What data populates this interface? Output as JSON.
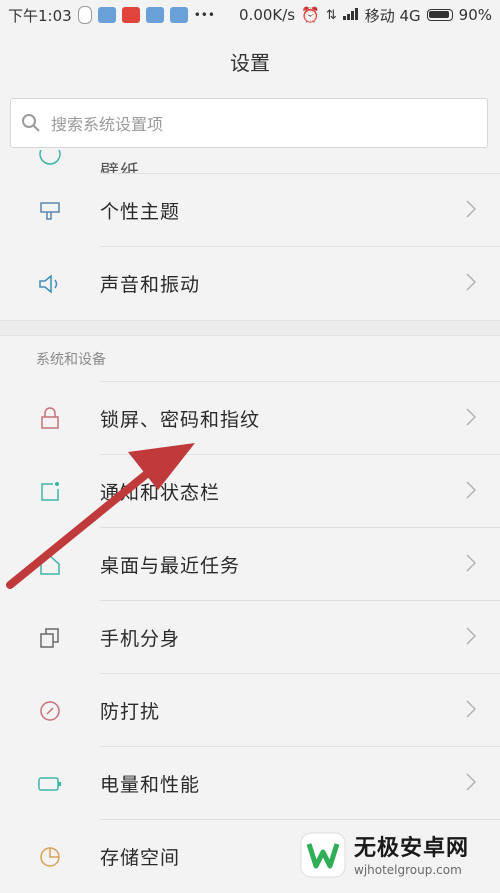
{
  "status_bar": {
    "time": "下午1:03",
    "more": "•••",
    "speed": "0.00K/s",
    "carrier": "移动 4G",
    "battery": "90%"
  },
  "header": {
    "title": "设置"
  },
  "search": {
    "placeholder": "搜索系统设置项"
  },
  "partial_item": {
    "label": "壁纸"
  },
  "items_top": [
    {
      "label": "个性主题",
      "icon": "theme-icon"
    },
    {
      "label": "声音和振动",
      "icon": "speaker-icon"
    }
  ],
  "section": {
    "title": "系统和设备"
  },
  "items_system": [
    {
      "label": "锁屏、密码和指纹",
      "icon": "lock-icon"
    },
    {
      "label": "通知和状态栏",
      "icon": "notification-icon"
    },
    {
      "label": "桌面与最近任务",
      "icon": "home-icon"
    },
    {
      "label": "手机分身",
      "icon": "dual-apps-icon"
    },
    {
      "label": "防打扰",
      "icon": "do-not-disturb-icon"
    },
    {
      "label": "电量和性能",
      "icon": "battery-icon"
    },
    {
      "label": "存储空间",
      "icon": "storage-icon"
    }
  ],
  "watermark": {
    "title": "无极安卓网",
    "url": "wjhotelgroup.com"
  },
  "colors": {
    "accent_teal": "#3fb5a7",
    "lock_red": "#c8707a",
    "arrow_red": "#c0393b"
  }
}
